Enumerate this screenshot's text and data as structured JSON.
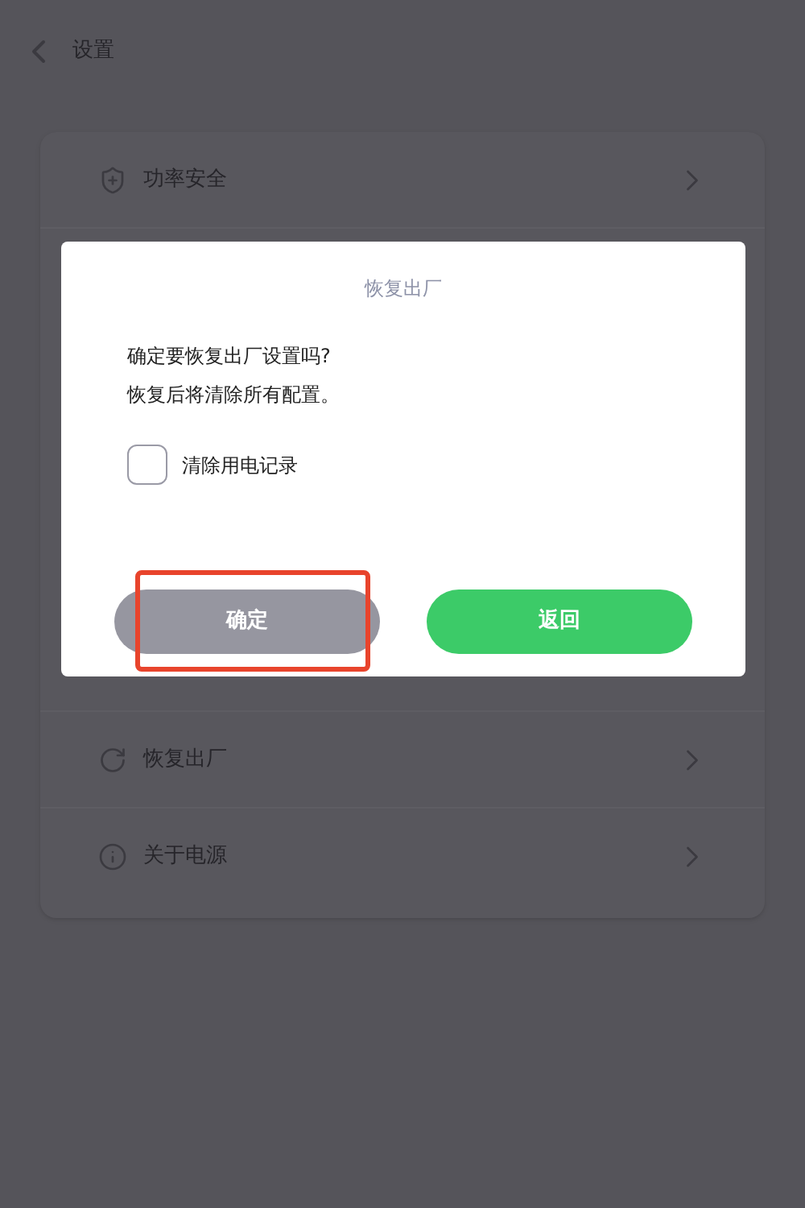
{
  "header": {
    "title": "设置"
  },
  "menu": {
    "items": [
      {
        "label": "功率安全"
      },
      {
        "label": "恢复出厂"
      },
      {
        "label": "关于电源"
      }
    ]
  },
  "dialog": {
    "title": "恢复出厂",
    "message": [
      "确定要恢复出厂设置吗?",
      "恢复后将清除所有配置。"
    ],
    "checkbox": {
      "label": "清除用电记录",
      "checked": false
    },
    "buttons": [
      {
        "label": "确定",
        "kind": "secondary",
        "highlighted": true
      },
      {
        "label": "返回",
        "kind": "primary",
        "highlighted": false
      }
    ]
  }
}
